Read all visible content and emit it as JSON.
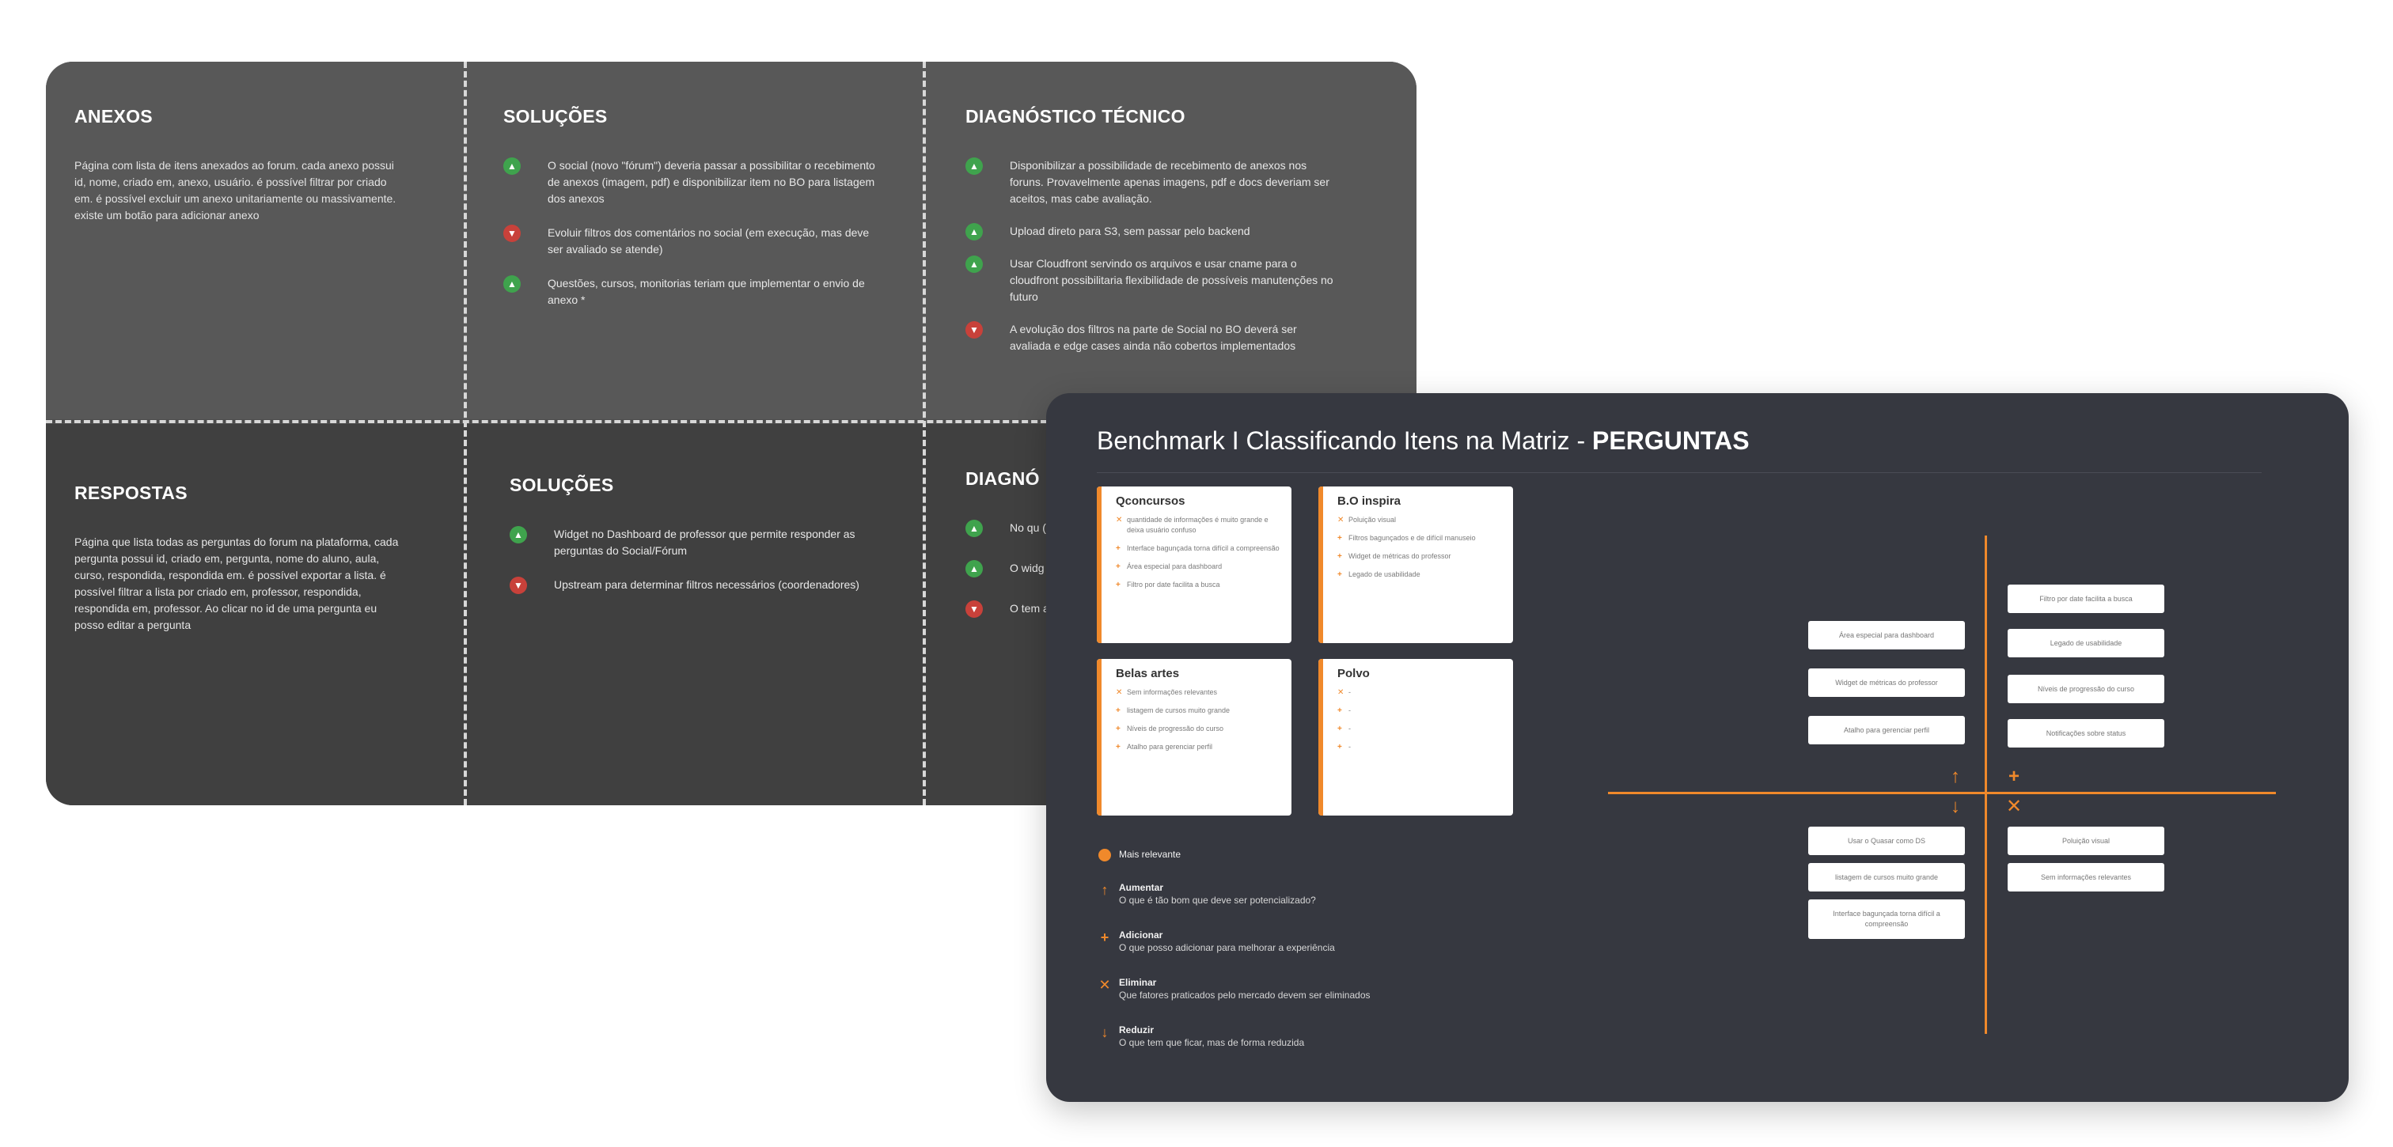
{
  "board": {
    "anexos": {
      "title": "ANEXOS",
      "description": "Página com lista de itens anexados ao forum. cada anexo possui id, nome, criado em, anexo, usuário. é possível filtrar por criado em. é possível excluir um anexo unitariamente ou massivamente. existe um botão para adicionar anexo"
    },
    "solucoes_top": {
      "title": "SOLUÇÕES",
      "items": [
        {
          "sentiment": "up",
          "text": "O social (novo \"fórum\") deveria passar a possibilitar o recebimento de anexos (imagem, pdf) e disponibilizar item no BO para listagem dos anexos"
        },
        {
          "sentiment": "down",
          "text": "Evoluir filtros dos comentários no social (em execução, mas deve ser avaliado se atende)"
        },
        {
          "sentiment": "up",
          "text": "Questões, cursos, monitorias teriam que implementar o envio de anexo *"
        }
      ]
    },
    "diagnostico_top": {
      "title": "DIAGNÓSTICO TÉCNICO",
      "items": [
        {
          "sentiment": "up",
          "text": "Disponibilizar a possibilidade de recebimento de anexos nos foruns. Provavelmente apenas imagens, pdf e docs deveriam ser aceitos, mas cabe avaliação."
        },
        {
          "sentiment": "up",
          "text": "Upload direto para S3, sem passar pelo backend"
        },
        {
          "sentiment": "up",
          "text": "Usar Cloudfront servindo os arquivos e usar cname para o cloudfront possibilitaria flexibilidade de possíveis manutenções no futuro"
        },
        {
          "sentiment": "down",
          "text": "A evolução dos filtros na parte de Social no BO deverá ser avaliada e edge cases ainda não cobertos implementados"
        }
      ]
    },
    "respostas": {
      "title": "RESPOSTAS",
      "description": "Página que lista todas as perguntas do forum na plataforma, cada pergunta possui id, criado em, pergunta, nome do aluno, aula, curso, respondida, respondida em. é possível exportar a lista. é possível filtrar a lista por criado em, professor, respondida, respondida em, professor. Ao clicar no id de uma pergunta eu posso editar a pergunta"
    },
    "solucoes_bottom": {
      "title": "SOLUÇÕES",
      "items": [
        {
          "sentiment": "up",
          "text": "Widget no Dashboard de professor que permite responder as perguntas do Social/Fórum"
        },
        {
          "sentiment": "down",
          "text": "Upstream para determinar filtros necessários (coordenadores)"
        }
      ]
    },
    "diagnostico_bottom": {
      "title": "DIAGNÓ",
      "items": [
        {
          "sentiment": "up",
          "text": "No qu (novo deve i permit foruns"
        },
        {
          "sentiment": "up",
          "text": "O widg do fór da for mais a"
        },
        {
          "sentiment": "down",
          "text": "O tem avalia releva seria b"
        }
      ]
    }
  },
  "bench": {
    "title_prefix": "Benchmark I Classificando Itens na Matriz - ",
    "title_bold": "PERGUNTAS",
    "cards": [
      {
        "name": "Qconcursos",
        "items": [
          {
            "mark": "x",
            "text": "quantidade de informações é muito grande e deixa usuário confuso"
          },
          {
            "mark": "+",
            "text": "Interface bagunçada torna difícil a compreensão"
          },
          {
            "mark": "+",
            "text": "Área especial para dashboard"
          },
          {
            "mark": "+",
            "text": "Filtro por date facilita a busca"
          }
        ]
      },
      {
        "name": "B.O inspira",
        "items": [
          {
            "mark": "x",
            "text": "Poluição visual"
          },
          {
            "mark": "+",
            "text": "Filtros bagunçados e de difícil manuseio"
          },
          {
            "mark": "+",
            "text": "Widget de métricas do professor"
          },
          {
            "mark": "+",
            "text": "Legado de usabilidade"
          }
        ]
      },
      {
        "name": "Belas artes",
        "items": [
          {
            "mark": "x",
            "text": "Sem informações relevantes"
          },
          {
            "mark": "+",
            "text": "listagem de cursos muito grande"
          },
          {
            "mark": "+",
            "text": "Níveis de progressão do curso"
          },
          {
            "mark": "+",
            "text": "Atalho para gerenciar perfil"
          }
        ]
      },
      {
        "name": "Polvo",
        "items": [
          {
            "mark": "x",
            "text": "-"
          },
          {
            "mark": "+",
            "text": "-"
          },
          {
            "mark": "+",
            "text": "-"
          },
          {
            "mark": "+",
            "text": "-"
          }
        ]
      }
    ],
    "legend": {
      "relevant": "Mais relevante",
      "items": [
        {
          "icon": "arrow-up",
          "title": "Aumentar",
          "desc": "O que é tão bom que deve ser potencializado?"
        },
        {
          "icon": "plus",
          "title": "Adicionar",
          "desc": "O que posso adicionar para melhorar a experiência"
        },
        {
          "icon": "cross",
          "title": "Eliminar",
          "desc": "Que fatores praticados pelo mercado devem ser eliminados"
        },
        {
          "icon": "arrow-down",
          "title": "Reduzir",
          "desc": "O que tem que ficar,  mas de forma reduzida"
        }
      ]
    },
    "matrix": {
      "left_top": [
        "Área especial para dashboard",
        "Widget de métricas do professor",
        "Atalho para gerenciar perfil"
      ],
      "right_top": [
        "Filtro por date facilita a busca",
        "Legado de usabilidade",
        "Níveis de progressão do curso",
        "Notificações sobre status"
      ],
      "left_bottom": [
        "Usar o Quasar como DS",
        "listagem de cursos muito grande",
        "Interface bagunçada torna difícil a compreensão"
      ],
      "right_bottom": [
        "Poluição visual",
        "Sem informações relevantes"
      ]
    },
    "accent_color": "#f0892b"
  }
}
